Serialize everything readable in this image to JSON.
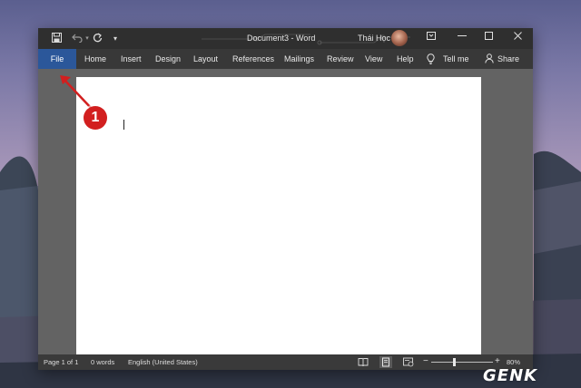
{
  "titlebar": {
    "quick_access": [
      "save-icon",
      "undo-icon",
      "redo-icon",
      "customize-icon"
    ],
    "title": "Document3  -  Word",
    "user_name": "Thái Học",
    "window_buttons": [
      "ribbon-display-icon",
      "minimize-icon",
      "maximize-icon",
      "close-icon"
    ]
  },
  "ribbon": {
    "tabs": [
      "File",
      "Home",
      "Insert",
      "Design",
      "Layout",
      "References",
      "Mailings",
      "Review",
      "View",
      "Help"
    ],
    "tell_me": "Tell me",
    "share": "Share"
  },
  "statusbar": {
    "page": "Page 1 of 1",
    "words": "0 words",
    "language": "English (United States)",
    "zoom": "80%",
    "zoom_minus": "−",
    "zoom_plus": "+"
  },
  "annotation": {
    "step": "1"
  },
  "watermark": "GENK",
  "colors": {
    "file_tab": "#2b579a",
    "callout": "#d21f1f",
    "ribbon": "#383838",
    "titlebar": "#2f2f2f"
  }
}
